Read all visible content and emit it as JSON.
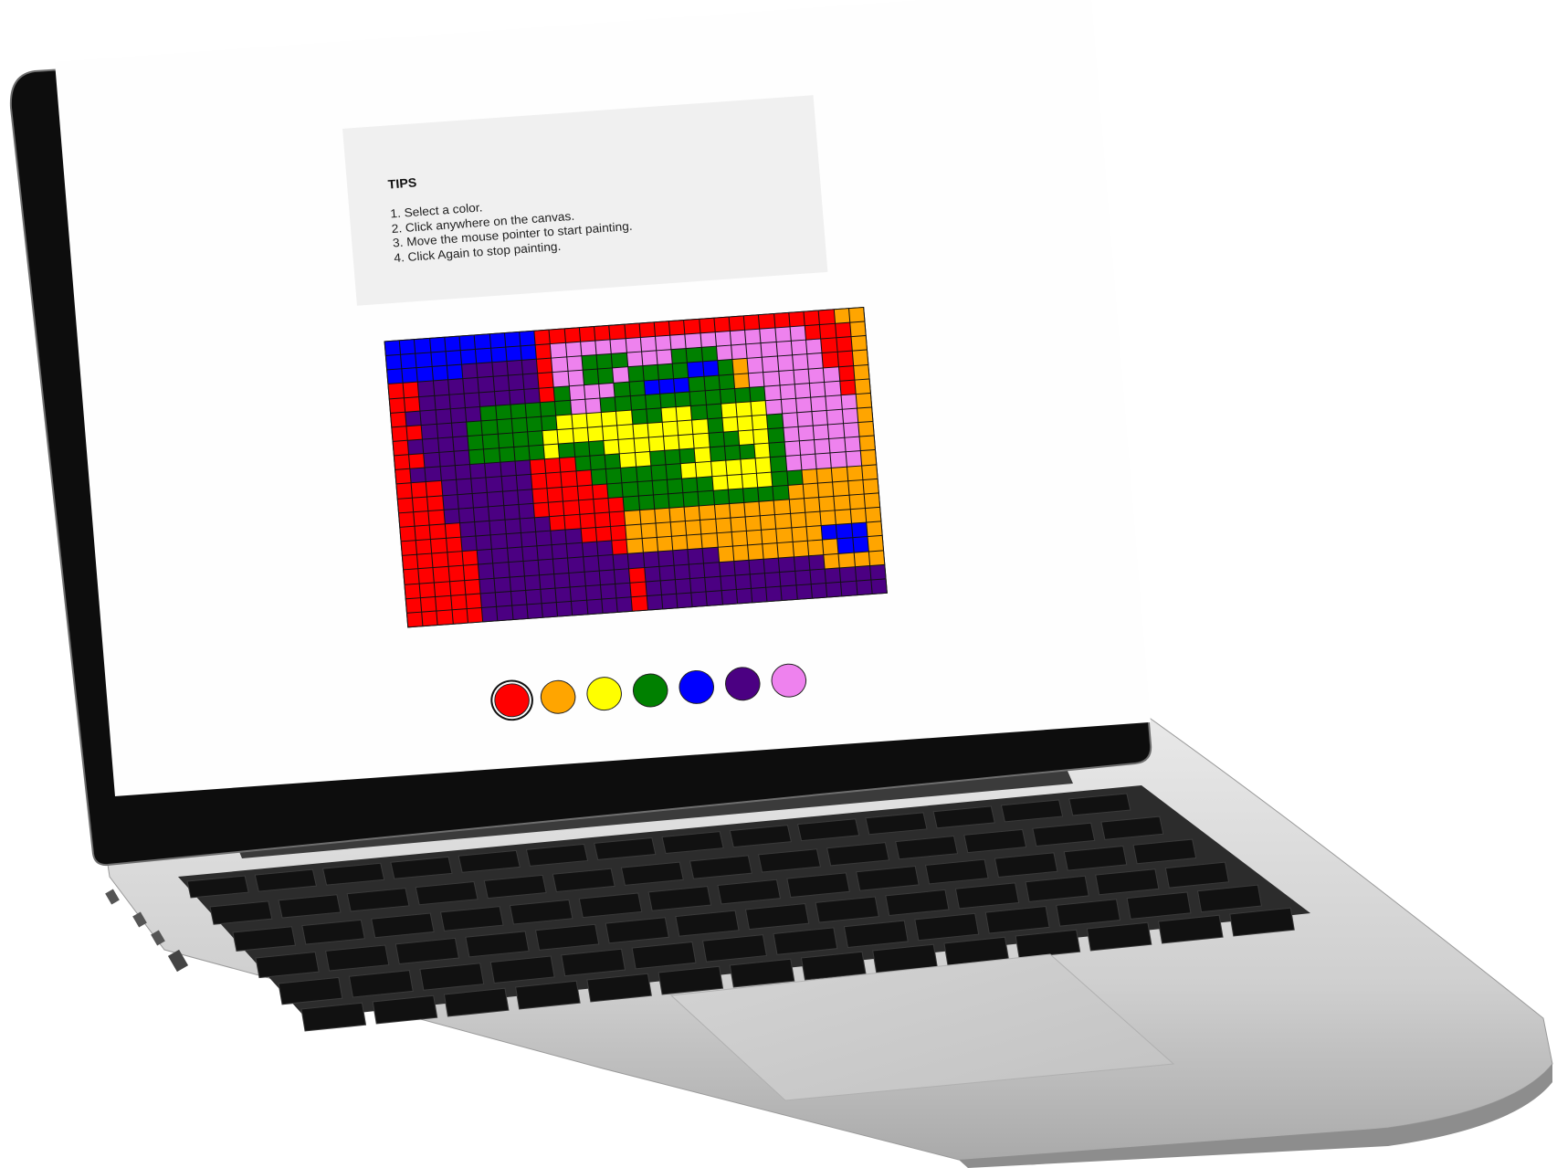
{
  "tips": {
    "title": "TIPS",
    "items": [
      "1. Select a color.",
      "2. Click anywhere on the canvas.",
      "3. Move the mouse pointer to start painting.",
      "4. Click Again to stop painting."
    ]
  },
  "palette": {
    "colors": [
      {
        "name": "red",
        "hex": "#ff0000",
        "selected": true
      },
      {
        "name": "orange",
        "hex": "#ffa500",
        "selected": false
      },
      {
        "name": "yellow",
        "hex": "#ffff00",
        "selected": false
      },
      {
        "name": "green",
        "hex": "#008000",
        "selected": false
      },
      {
        "name": "blue",
        "hex": "#0000ff",
        "selected": false
      },
      {
        "name": "indigo",
        "hex": "#4b0082",
        "selected": false
      },
      {
        "name": "violet",
        "hex": "#ee82ee",
        "selected": false
      }
    ]
  },
  "canvas": {
    "columns": 32,
    "rows": 20,
    "legend": {
      "R": "#ff0000",
      "O": "#ffa500",
      "Y": "#ffff00",
      "G": "#008000",
      "B": "#0000ff",
      "I": "#4b0082",
      "V": "#ee82ee",
      "W": "#ffffff"
    },
    "grid": [
      "BBBBBBBBBBRRRRRRRRRRRRRRRRRRRROO",
      "BBBBBBBBBBRVVVVVVVVVVVVVVVVVRRRO",
      "BBBBBIIIIIRVVGGGVVVGGGVVVVVVVRRO",
      "RRIIIIIIIIRVVGGVGGGGBBGOVVVVVRRO",
      "RRIIIIIIIIRGVVVGGBBBGGGOVVVVVVRO",
      "RIIIIIGGGGGGVVGGGGGGGGGGGVVVVVRO",
      "RRIIIGGGGGGYYYYYGGYYGGYYYVVVVVVO",
      "RIIIIGGGGGYYYYYYYYYYYGYYYGVVVVVO",
      "RRIIIGGGGGYGGGYYYYYYYGGYYGVVVVVO",
      "RIIIIIIIIRRRGGGYYGGGYGGGYGVVVVVO",
      "RRRIIIIIIRRRRGGGGGGYYYYYYGVVVVVO",
      "RRRIIIIIIRRRRRGGGGGGGYYYYGGOOOOO",
      "RRRIIIIIIRRRRRRGGGGGGGGGGGOOOOOO",
      "RRRRIIIIIIRRRRROOOOOOOOOOOOOOOOO",
      "RRRRIIIIIIIIRRROOOOOOOOOOOOOOOOO",
      "RRRRRIIIIIIIIIROOOOOOOOOOOOOBBBO",
      "RRRRRIIIIIIIIIIIIIIIIOOOOOOOOBBO",
      "RRRRRIIIIIIIIIIRIIIIIIIIIIIIOOOO",
      "RRRRRIIIIIIIIIIRIIIIIIIIIIIIIIII",
      "RRRRRIIIIIIIIIIRIIIIIIIIIIIIIIII"
    ]
  }
}
